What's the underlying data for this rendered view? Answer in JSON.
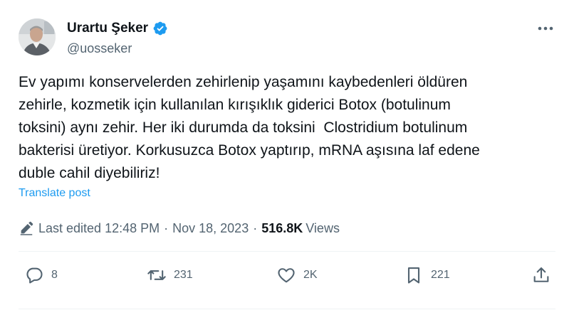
{
  "author": {
    "display_name": "Urartu Şeker",
    "handle": "@uosseker",
    "verified_color": "#1d9bf0"
  },
  "tweet": {
    "text": "Ev yapımı konservelerden zehirlenip yaşamını kaybedenleri öldüren\nzehirle, kozmetik için kullanılan kırışıklık giderici Botox (botulinum\ntoksini) aynı zehir. Her iki durumda da toksini  Clostridium botulinum\nbakterisi üretiyor. Korkusuzca Botox yaptırıp, mRNA aşısına laf edene\nduble cahil diyebiliriz!",
    "translate_label": "Translate post"
  },
  "meta": {
    "edited_label": "Last edited 12:48 PM",
    "separator": "·",
    "date": "Nov 18, 2023",
    "views_count": "516.8K",
    "views_label": "Views"
  },
  "actions": {
    "replies": "8",
    "retweets": "231",
    "likes": "2K",
    "bookmarks": "221"
  },
  "colors": {
    "text": "#0f1419",
    "secondary": "#536471",
    "link": "#1d9bf0",
    "divider": "#eff3f4"
  },
  "icons": [
    "more-icon",
    "verified-badge-icon",
    "pencil-edit-icon",
    "reply-icon",
    "retweet-icon",
    "like-icon",
    "bookmark-icon",
    "share-icon"
  ]
}
